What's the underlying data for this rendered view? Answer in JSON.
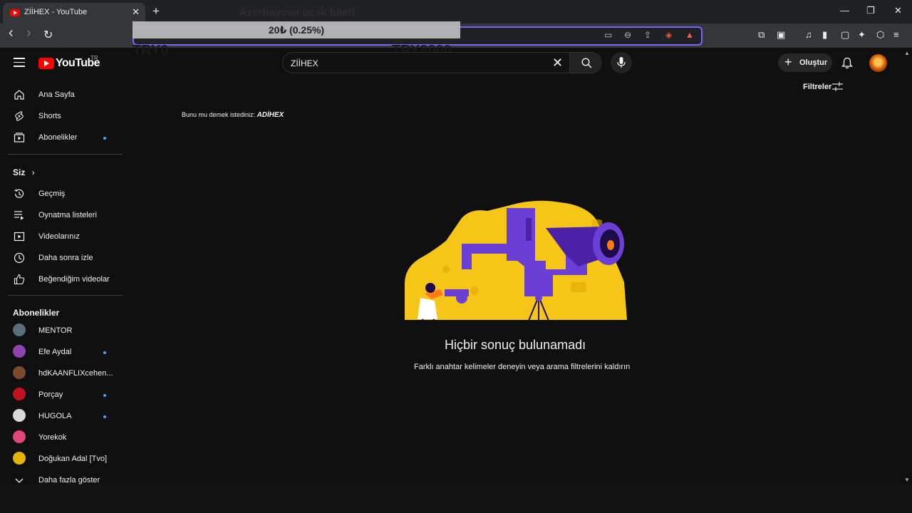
{
  "browser": {
    "tab_title": "ZİİHEX - YouTube",
    "tab_close": "✕",
    "new_tab": "+",
    "window": {
      "minimize": "—",
      "restore": "❐",
      "close": "✕"
    },
    "back": "‹",
    "forward": "›",
    "reload": "↻"
  },
  "overlay": {
    "title": "Azerbaycan uçak bileti",
    "price_change": "20₺ (0.25%)",
    "left_value": "TRY0",
    "right_value": "TRY8000"
  },
  "header": {
    "logo_text": "YouTube",
    "country_code": "TR",
    "search_value": "ZİİHEX",
    "create_label": "Oluştur"
  },
  "sidebar": {
    "main": [
      {
        "label": "Ana Sayfa",
        "icon": "home-icon"
      },
      {
        "label": "Shorts",
        "icon": "shorts-icon"
      },
      {
        "label": "Abonelikler",
        "icon": "subscriptions-icon"
      }
    ],
    "you_heading": "Siz",
    "you": [
      {
        "label": "Geçmiş",
        "icon": "history-icon"
      },
      {
        "label": "Oynatma listeleri",
        "icon": "playlists-icon"
      },
      {
        "label": "Videolarınız",
        "icon": "your-videos-icon"
      },
      {
        "label": "Daha sonra izle",
        "icon": "watch-later-icon"
      },
      {
        "label": "Beğendiğim videolar",
        "icon": "liked-icon"
      }
    ],
    "subs_heading": "Abonelikler",
    "subscriptions": [
      {
        "label": "MENTOR",
        "color": "#5b6d7a",
        "new": false
      },
      {
        "label": "Efe Aydal",
        "color": "#8e44ad",
        "new": true
      },
      {
        "label": "hdKAANFLIXcehen...",
        "color": "#7a4a2c",
        "new": false
      },
      {
        "label": "Porçay",
        "color": "#c0121f",
        "new": true
      },
      {
        "label": "HUGOLA",
        "color": "#d9d9d9",
        "new": true
      },
      {
        "label": "Yorekok",
        "color": "#e0457b",
        "new": false
      },
      {
        "label": "Doğukan Adal [Tvo]",
        "color": "#e3b30a",
        "new": false
      }
    ],
    "show_more": "Daha fazla göster"
  },
  "main": {
    "did_you_mean_prefix": "Bunu mu demek istediniz: ",
    "did_you_mean_term": "ADİHEX",
    "filters_label": "Filtreler",
    "no_results_title": "Hiçbir sonuç bulunamadı",
    "no_results_subtitle": "Farklı anahtar kelimeler deneyin veya arama filtrelerini kaldırın"
  },
  "colors": {
    "accent_blue": "#3ea6ff",
    "brand_red": "#ff0000",
    "illustration_yellow": "#f5c518",
    "illustration_purple": "#6b3fd6"
  }
}
